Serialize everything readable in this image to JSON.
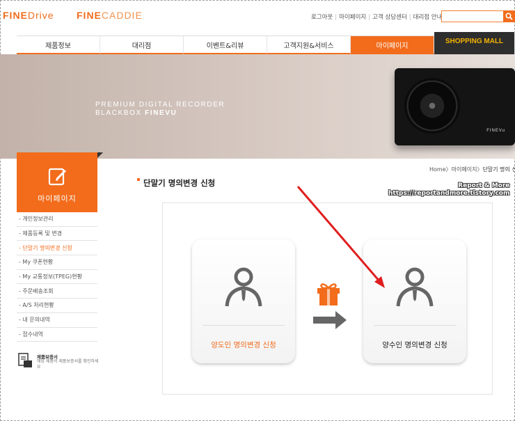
{
  "header": {
    "brand1": {
      "bold": "FINE",
      "thin": "Drive"
    },
    "brand2": {
      "bold": "FINE",
      "thin": "CADDIE"
    },
    "util_links": [
      "로그아웃",
      "마이페이지",
      "고객 상담센터",
      "대리점 안내"
    ],
    "search_placeholder": "",
    "search_icon": "search-icon"
  },
  "nav": {
    "items": [
      "제품정보",
      "대리점",
      "이벤트&리뷰",
      "고객지원&서비스",
      "마이페이지"
    ],
    "active_index": 4,
    "mall": "SHOPPING MALL"
  },
  "banner": {
    "line1": "PREMIUM DIGITAL RECORDER",
    "line2_prefix": "BLACKBOX",
    "line2_brand": "FINEVU",
    "device_logo": "FINEVu"
  },
  "sidebar": {
    "title": "마이페이지",
    "items": [
      "- 개인정보관리",
      "- 제품등록 및 변경",
      "- 단말기 명의변경 신청",
      "- My 쿠폰현황",
      "- My 교통정보(TPEG)현황",
      "- 주문배송조회",
      "- A/S 처리현황",
      "- 내 문의내역",
      "- 접수내역"
    ],
    "active_index": 2,
    "notice": {
      "title": "제품보증서",
      "desc": "해당 제품의 제품보증서를 확인하세요"
    }
  },
  "main": {
    "breadcrumb": {
      "home": "Home",
      "sep": "〉",
      "parent": "마이페이지",
      "current": "단말기 명의 신"
    },
    "page_title": "단말기 명의변경 신청",
    "watermark": {
      "line1": "Report & More",
      "line2": "https://reportandmore.tistory.com"
    },
    "cards": {
      "left_label": "양도인 명의변경 신청",
      "right_label": "양수인 명의변경 신청"
    }
  },
  "colors": {
    "accent": "#f26c1c",
    "mall_bg": "#2e2e2e",
    "mall_text": "#f5b400",
    "annotation_arrow": "#e01e1e"
  }
}
